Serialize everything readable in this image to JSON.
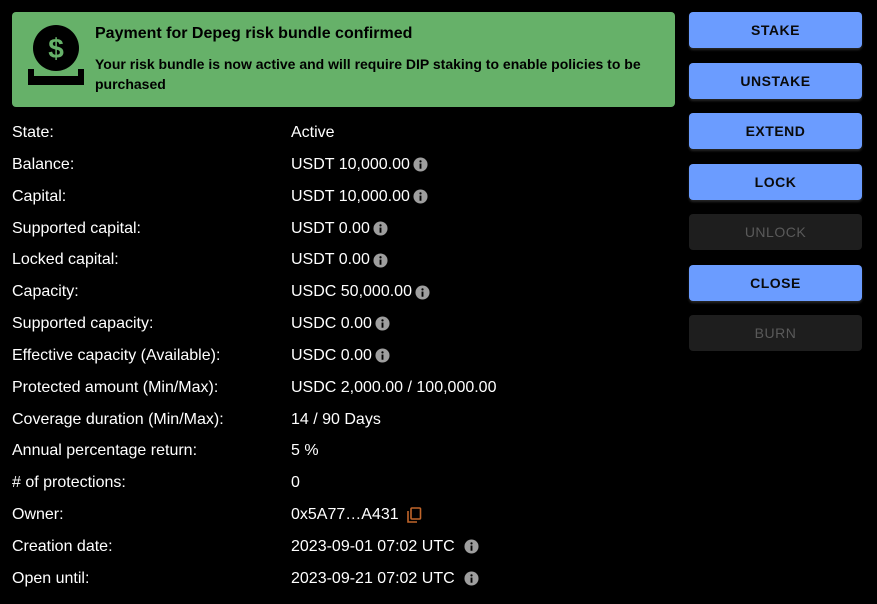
{
  "alert": {
    "title": "Payment for Depeg risk bundle confirmed",
    "message": "Your risk bundle is now active and will require DIP staking to enable policies to be purchased",
    "icon": "dollar-payment-icon",
    "background": "#66b169"
  },
  "details": [
    {
      "label": "State:",
      "value": "Active",
      "info": false
    },
    {
      "label": "Balance:",
      "value": "USDT 10,000.00",
      "info": true
    },
    {
      "label": "Capital:",
      "value": "USDT 10,000.00",
      "info": true
    },
    {
      "label": "Supported capital:",
      "value": "USDT 0.00",
      "info": true
    },
    {
      "label": "Locked capital:",
      "value": "USDT 0.00",
      "info": true
    },
    {
      "label": "Capacity:",
      "value": "USDC 50,000.00",
      "info": true
    },
    {
      "label": "Supported capacity:",
      "value": "USDC 0.00",
      "info": true
    },
    {
      "label": "Effective capacity (Available):",
      "value": "USDC 0.00",
      "info": true
    },
    {
      "label": "Protected amount (Min/Max):",
      "value": "USDC 2,000.00 / 100,000.00",
      "info": false
    },
    {
      "label": "Coverage duration (Min/Max):",
      "value": "14 / 90 Days",
      "info": false
    },
    {
      "label": "Annual percentage return:",
      "value": "5 %",
      "info": false
    },
    {
      "label": "# of protections:",
      "value": "0",
      "info": false
    },
    {
      "label": "Owner:",
      "value": "0x5A77…A431",
      "copy": true
    },
    {
      "label": "Creation date:",
      "value": "2023-09-01 07:02 UTC",
      "info": true
    },
    {
      "label": "Open until:",
      "value": "2023-09-21 07:02 UTC",
      "info": true
    }
  ],
  "actions": [
    {
      "label": "STAKE",
      "enabled": true
    },
    {
      "label": "UNSTAKE",
      "enabled": true
    },
    {
      "label": "EXTEND",
      "enabled": true
    },
    {
      "label": "LOCK",
      "enabled": true
    },
    {
      "label": "UNLOCK",
      "enabled": false
    },
    {
      "label": "CLOSE",
      "enabled": true
    },
    {
      "label": "BURN",
      "enabled": false
    }
  ],
  "colors": {
    "primary_button": "#6b9cff",
    "disabled_button": "#1e1e1e",
    "copy_icon": "#c0652a",
    "info_icon": "#9e9e9e"
  }
}
